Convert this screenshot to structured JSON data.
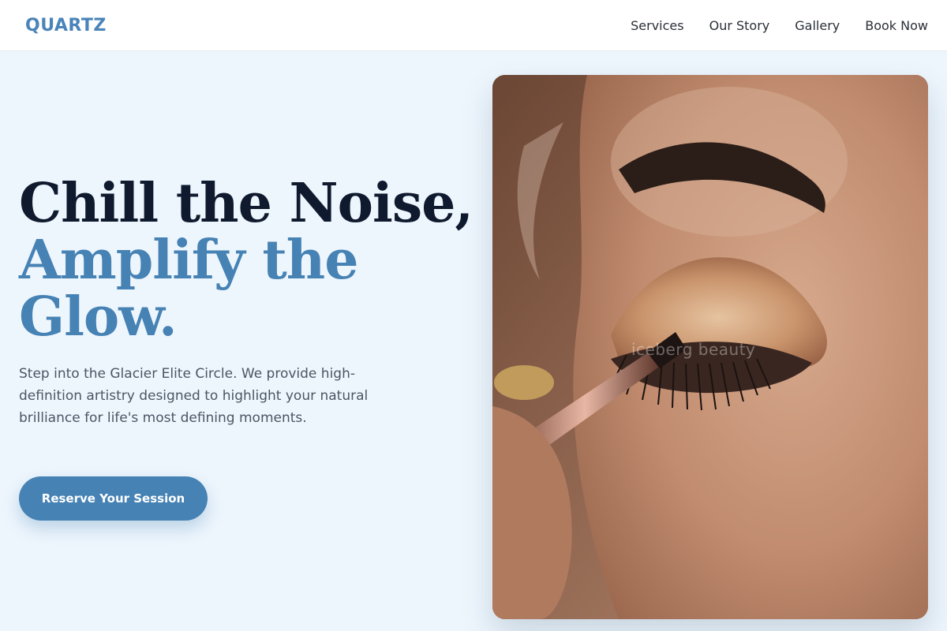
{
  "header": {
    "logo": "QUARTZ",
    "nav": [
      {
        "label": "Services"
      },
      {
        "label": "Our Story"
      },
      {
        "label": "Gallery"
      },
      {
        "label": "Book Now"
      }
    ]
  },
  "hero": {
    "headline_line1": "Chill the Noise,",
    "headline_line2": "Amplify the",
    "headline_line3": "Glow.",
    "description": "Step into the Glacier Elite Circle. We provide high-definition artistry designed to highlight your natural brilliance for life's most defining moments.",
    "cta_label": "Reserve Your Session",
    "image_watermark": "iceberg beauty"
  },
  "colors": {
    "accent": "#4682b4",
    "headline_dark": "#0f1a2e",
    "page_background": "#eef6fd",
    "header_background": "#ffffff"
  }
}
